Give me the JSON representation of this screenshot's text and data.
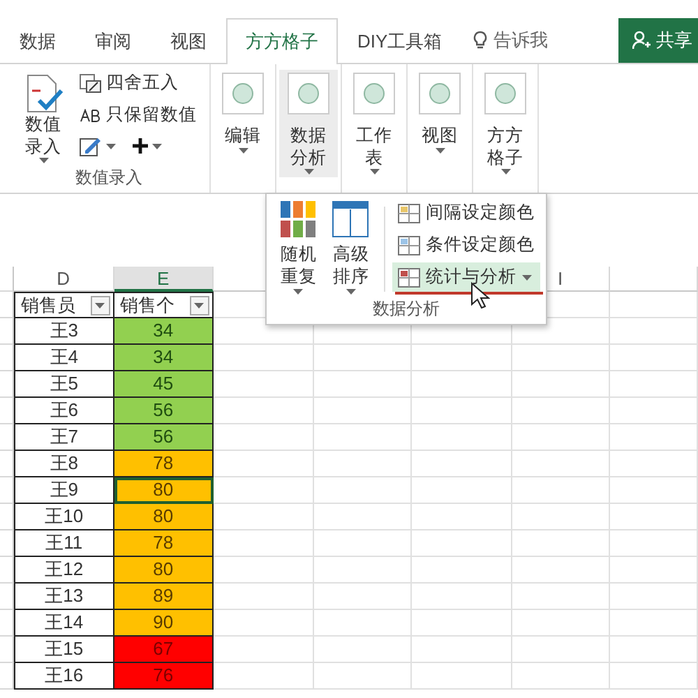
{
  "tabs": [
    {
      "label": "数据",
      "selected": false
    },
    {
      "label": "审阅",
      "selected": false
    },
    {
      "label": "视图",
      "selected": false
    },
    {
      "label": "方方格子",
      "selected": true
    },
    {
      "label": "DIY工具箱",
      "selected": false
    }
  ],
  "tell_me": "告诉我",
  "share_button": "共享",
  "ribbon": {
    "entry_group": {
      "big_button": "数值录入",
      "small_buttons": [
        "四舍五入",
        "只保留数值"
      ],
      "label": "数值录入"
    },
    "big_buttons": [
      {
        "label": "编辑",
        "selected": false
      },
      {
        "label": "数据分析",
        "selected": true
      },
      {
        "label": "工作表",
        "selected": false
      },
      {
        "label": "视图",
        "selected": false
      },
      {
        "label": "方方格子",
        "selected": false
      }
    ]
  },
  "popup": {
    "big_buttons": [
      "随机重复",
      "高级排序"
    ],
    "items": [
      {
        "label": "间隔设定颜色",
        "selected": false,
        "dropdown": false
      },
      {
        "label": "条件设定颜色",
        "selected": false,
        "dropdown": false
      },
      {
        "label": "统计与分析",
        "selected": true,
        "dropdown": true
      }
    ],
    "label": "数据分析"
  },
  "sheet": {
    "columns": [
      "D",
      "E",
      "",
      "",
      "",
      "I",
      ""
    ],
    "headers": [
      "销售员",
      "销售个"
    ],
    "rows": [
      {
        "name": "王3",
        "value": "34",
        "kind": "good",
        "selected": false
      },
      {
        "name": "王4",
        "value": "34",
        "kind": "good",
        "selected": false
      },
      {
        "name": "王5",
        "value": "45",
        "kind": "good",
        "selected": false
      },
      {
        "name": "王6",
        "value": "56",
        "kind": "good",
        "selected": false
      },
      {
        "name": "王7",
        "value": "56",
        "kind": "good",
        "selected": false
      },
      {
        "name": "王8",
        "value": "78",
        "kind": "mid",
        "selected": false
      },
      {
        "name": "王9",
        "value": "80",
        "kind": "mid",
        "selected": true
      },
      {
        "name": "王10",
        "value": "80",
        "kind": "mid",
        "selected": false
      },
      {
        "name": "王11",
        "value": "78",
        "kind": "mid",
        "selected": false
      },
      {
        "name": "王12",
        "value": "80",
        "kind": "mid",
        "selected": false
      },
      {
        "name": "王13",
        "value": "89",
        "kind": "mid",
        "selected": false
      },
      {
        "name": "王14",
        "value": "90",
        "kind": "mid",
        "selected": false
      },
      {
        "name": "王15",
        "value": "67",
        "kind": "bad",
        "selected": false
      },
      {
        "name": "王16",
        "value": "76",
        "kind": "bad",
        "selected": false
      }
    ]
  }
}
